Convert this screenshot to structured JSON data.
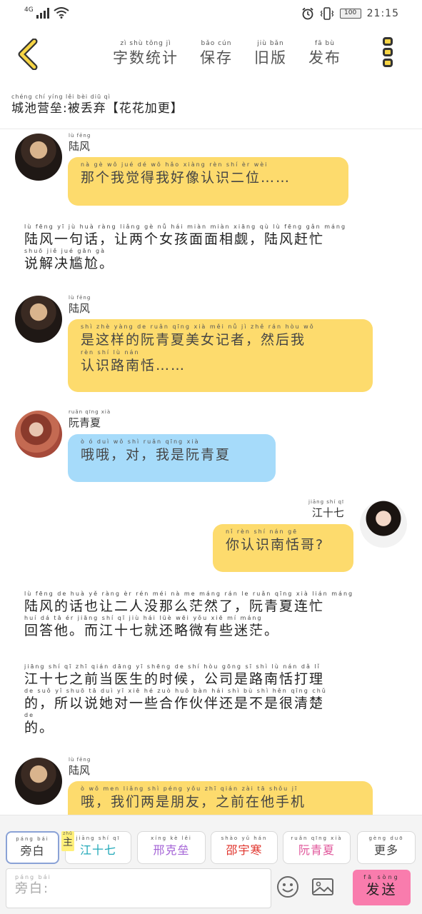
{
  "status_bar": {
    "network": "4G",
    "battery": "100",
    "time": "21:15",
    "icons": [
      "signal-icon",
      "wifi-icon",
      "alarm-icon",
      "vibrate-icon",
      "battery-icon"
    ]
  },
  "header": {
    "nav": [
      {
        "py": "zì shù tǒng jì",
        "hz": "字数统计"
      },
      {
        "py": "bǎo cún",
        "hz": "保存"
      },
      {
        "py": "jiù bǎn",
        "hz": "旧版"
      },
      {
        "py": "fā bù",
        "hz": "发布"
      }
    ],
    "icons": [
      "back-chevron-icon",
      "more-icon"
    ]
  },
  "title": {
    "py": "chéng chí yíng lěi  bèi diū qì",
    "hz": "城池营垒:被丢弃【花花加更】"
  },
  "chat": {
    "m1": {
      "speaker_py": "lù fēng",
      "speaker": "陆风",
      "py": "nà gè wǒ jué dé wǒ hǎo xiàng rèn shí èr wèi",
      "hz": "那个我觉得我好像认识二位……"
    },
    "n1": {
      "py1": "lù fēng yī jù huà   ràng liǎng gè nǚ hái miàn miàn xiāng qù   lù fēng gǎn máng",
      "hz1": "陆风一句话，让两个女孩面面相觑，陆风赶忙",
      "py2": "shuō jiě jué gān gà",
      "hz2": "说解决尴尬。"
    },
    "m2": {
      "speaker_py": "lù fēng",
      "speaker": "陆风",
      "py1": "shì zhè yàng de ruǎn qīng xià měi nǚ jì zhě   rán hòu wǒ",
      "hz1": "是这样的阮青夏美女记者，然后我",
      "py2": "rèn shí lù nán",
      "hz2": "认识路南恬……"
    },
    "m3": {
      "speaker_py": "ruǎn qīng xià",
      "speaker": "阮青夏",
      "py": "ò ó   duì   wǒ shì ruǎn qīng xià",
      "hz": "哦哦，对，我是阮青夏"
    },
    "m4": {
      "speaker_py": "jiāng shí qī",
      "speaker": "江十七",
      "py": "nǐ rèn shí nán gē",
      "hz": "你认识南恬哥?"
    },
    "n2": {
      "py1": "lù fēng de huà yě ràng èr rén méi nà me máng rán le   ruǎn qīng xià lián máng",
      "hz1": "陆风的话也让二人没那么茫然了，阮青夏连忙",
      "py2": "huí dá tā   ér jiāng shí qī jiù hái lüè wēi yǒu xiē mí máng",
      "hz2": "回答他。而江十七就还略微有些迷茫。"
    },
    "n3": {
      "py1": "jiāng shí qī zhī qián dāng yī shēng de shí hòu   gōng sī shì lù nán dǎ lǐ",
      "hz1": "江十七之前当医生的时候，公司是路南恬打理",
      "py2": "de   suǒ yǐ shuō tā duì yī xiē hé zuò huǒ bàn hái shì bù shì hěn qīng chǔ",
      "hz2": "的，所以说她对一些合作伙伴还是不是很清楚",
      "py3": "de",
      "hz3": "的。"
    },
    "m5": {
      "speaker_py": "lù fēng",
      "speaker": "陆风",
      "py": "ò   wǒ men liǎng shì péng yǒu   zhī qián zài tā shǒu jī",
      "hz": "哦，我们两是朋友，之前在他手机"
    }
  },
  "bottom": {
    "main_tag": {
      "py": "zhǔ",
      "hz": "主"
    },
    "roles": [
      {
        "py": "páng bái",
        "hz": "旁白",
        "color": "#444444"
      },
      {
        "py": "jiāng shí qī",
        "hz": "江十七",
        "color": "#1fa8b8"
      },
      {
        "py": "xíng kè lěi",
        "hz": "邢克垒",
        "color": "#a463d6"
      },
      {
        "py": "shào yǔ hán",
        "hz": "邵宇寒",
        "color": "#e0332b"
      },
      {
        "py": "ruǎn qīng xià",
        "hz": "阮青夏",
        "color": "#e0559a"
      },
      {
        "py": "gèng duō",
        "hz": "更多",
        "color": "#444444"
      }
    ],
    "input_py": "páng bái",
    "input_placeholder": "旁白:",
    "send": {
      "py": "fā sòng",
      "hz": "发送"
    },
    "icons": [
      "emoji-icon",
      "image-icon"
    ]
  }
}
